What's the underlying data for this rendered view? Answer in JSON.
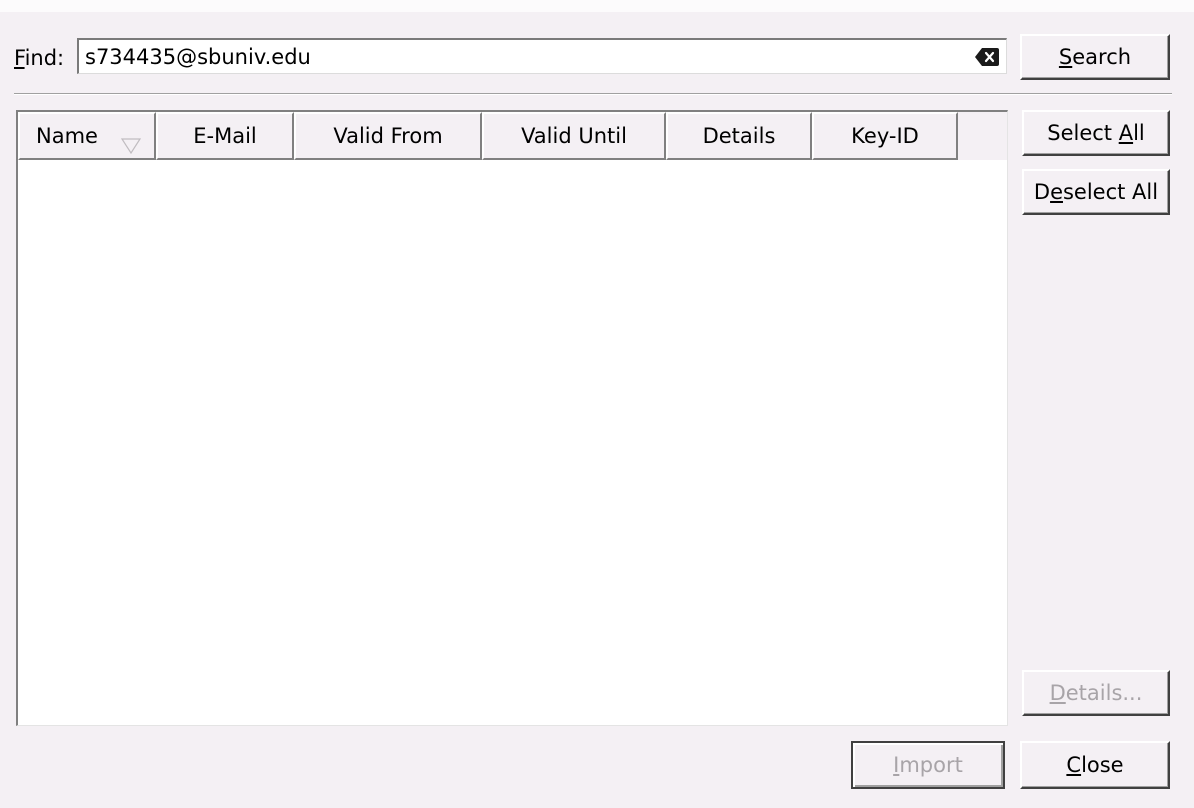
{
  "find": {
    "label_pre": "",
    "label_mnemonic": "F",
    "label_post": "ind:",
    "value": "s734435@sbuniv.edu"
  },
  "buttons": {
    "search": {
      "pre": "",
      "mnemonic": "S",
      "post": "earch"
    },
    "select_all": {
      "pre": "Select ",
      "mnemonic": "A",
      "post": "ll"
    },
    "deselect_all": {
      "pre": "D",
      "mnemonic": "e",
      "post": "select All"
    },
    "details": {
      "pre": "",
      "mnemonic": "D",
      "post": "etails..."
    },
    "import": {
      "pre": "",
      "mnemonic": "I",
      "post": "mport"
    },
    "close": {
      "pre": "",
      "mnemonic": "C",
      "post": "lose"
    }
  },
  "table": {
    "columns": [
      "Name",
      "E-Mail",
      "Valid From",
      "Valid Until",
      "Details",
      "Key-ID"
    ],
    "sort_column": "Name",
    "rows": []
  },
  "states": {
    "details_enabled": false,
    "import_enabled": false
  },
  "icons": {
    "clear": "clear-text-icon",
    "sort": "sort-descending-icon"
  }
}
